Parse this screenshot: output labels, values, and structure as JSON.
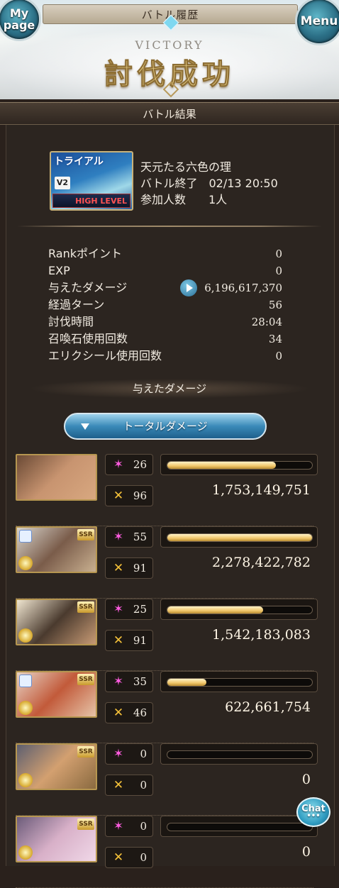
{
  "header": {
    "title": "バトル履歴",
    "mypage_label": "My\npage",
    "menu_label": "Menu",
    "victory": "VICTORY",
    "result_banner": "討伐成功"
  },
  "section_title": "バトル結果",
  "quest": {
    "badge_label": "トライアル",
    "version": "V2",
    "difficulty": "HIGH LEVEL",
    "name": "天元たる六色の理",
    "end_line": "バトル終了　02/13 20:50",
    "participants_line": "参加人数　　1人"
  },
  "stats": [
    {
      "label": "Rankポイント",
      "value": "0"
    },
    {
      "label": "EXP",
      "value": "0"
    },
    {
      "label": "与えたダメージ",
      "value": "6,196,617,370"
    },
    {
      "label": "経過ターン",
      "value": "56"
    },
    {
      "label": "討伐時間",
      "value": "28:04"
    },
    {
      "label": "召喚石使用回数",
      "value": "34"
    },
    {
      "label": "エリクシール使用回数",
      "value": "0"
    }
  ],
  "damage_section_title": "与えたダメージ",
  "total_damage_button": "トータルダメージ",
  "characters": [
    {
      "name": "main-character",
      "skills": "26",
      "ougi": "96",
      "damage": "1,753,149,751",
      "bar_fraction": 0.75,
      "ssr": false,
      "element_icon": false,
      "colors": [
        "#6b4a35",
        "#c89470",
        "#d8a880"
      ]
    },
    {
      "name": "character-2",
      "skills": "55",
      "ougi": "91",
      "damage": "2,278,422,782",
      "bar_fraction": 1.0,
      "ssr": true,
      "element_icon": true,
      "colors": [
        "#d8d4cc",
        "#7a5c4a",
        "#c9b090"
      ]
    },
    {
      "name": "character-3",
      "skills": "25",
      "ougi": "91",
      "damage": "1,542,183,083",
      "bar_fraction": 0.66,
      "ssr": true,
      "element_icon": false,
      "colors": [
        "#f0e6d0",
        "#4a3a2e",
        "#c79a74"
      ]
    },
    {
      "name": "character-4",
      "skills": "35",
      "ougi": "46",
      "damage": "622,661,754",
      "bar_fraction": 0.27,
      "ssr": true,
      "element_icon": true,
      "colors": [
        "#e7d2c4",
        "#c25a3a",
        "#e6c4a8"
      ]
    },
    {
      "name": "character-5",
      "skills": "0",
      "ougi": "0",
      "damage": "0",
      "bar_fraction": 0,
      "ssr": true,
      "element_icon": false,
      "colors": [
        "#5d5f70",
        "#d3a070",
        "#8a6a40"
      ]
    },
    {
      "name": "character-6",
      "skills": "0",
      "ougi": "0",
      "damage": "0",
      "bar_fraction": 0,
      "ssr": true,
      "element_icon": false,
      "colors": [
        "#6c5c7a",
        "#d8b0c8",
        "#f0d8e8"
      ]
    }
  ],
  "chat_label": "Chat",
  "colors": {
    "background": "#2a211c",
    "bar_gold": "#f0c66a",
    "skill_pink": "#ff5ce0",
    "ougi_gold": "#f6c23a",
    "button_blue": "#3a8ab8"
  }
}
